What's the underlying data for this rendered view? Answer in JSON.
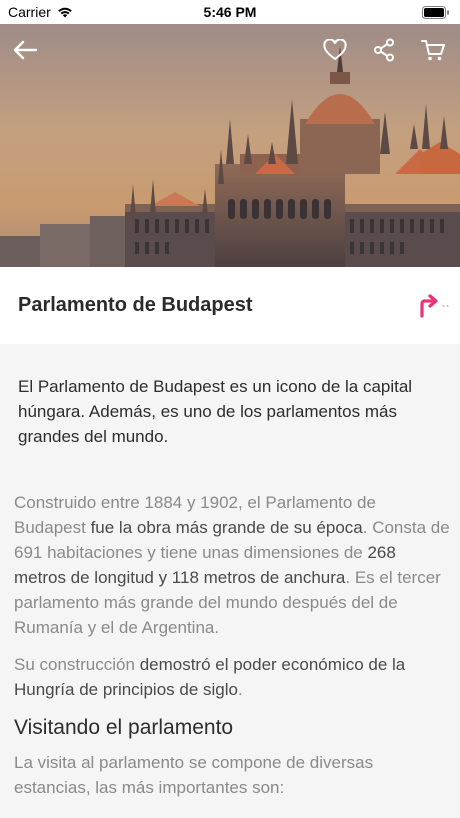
{
  "status_bar": {
    "carrier": "Carrier",
    "time": "5:46 PM"
  },
  "header_icons": [
    "back-arrow-icon",
    "heart-icon",
    "share-icon",
    "cart-icon"
  ],
  "title": "Parlamento de Budapest",
  "intro": "El Parlamento de Budapest es un icono de la capital húngara. Además, es uno de los parlamentos más grandes del mundo.",
  "paragraph1": {
    "s1": "Construido entre 1884 y 1902, el Parlamento de Budapest ",
    "b1": "fue la obra más grande de su época",
    "s2": ". Consta de 691 habitaciones y tiene unas dimensiones de ",
    "b2": "268 metros de longitud y 118 metros de anchura",
    "s3": ". Es el tercer parlamento más grande del mundo después del de Rumanía y el de Argentina."
  },
  "paragraph2": {
    "s1": "Su construcción ",
    "b1": "demostró el poder económico de la Hungría de principios de siglo",
    "s2": "."
  },
  "section_heading": "Visitando el parlamento",
  "paragraph3": "La visita al parlamento se compone de diversas estancias, las más importantes son:",
  "colors": {
    "accent": "#e6337a",
    "heading": "#2b2b2b",
    "body_text": "#8a8a8a",
    "background": "#f5f5f5"
  }
}
